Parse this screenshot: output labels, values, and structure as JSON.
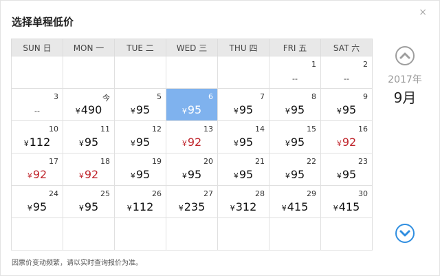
{
  "title": "选择单程低价",
  "close_symbol": "×",
  "weekdays": [
    "SUN 日",
    "MON 一",
    "TUE 二",
    "WED 三",
    "THU 四",
    "FRI 五",
    "SAT 六"
  ],
  "currency": "¥",
  "weeks": [
    [
      {
        "day": "",
        "price": ""
      },
      {
        "day": "",
        "price": ""
      },
      {
        "day": "",
        "price": ""
      },
      {
        "day": "",
        "price": ""
      },
      {
        "day": "",
        "price": ""
      },
      {
        "day": "1",
        "price": "--"
      },
      {
        "day": "2",
        "price": "--"
      }
    ],
    [
      {
        "day": "3",
        "price": "--"
      },
      {
        "day": "今",
        "price": "490"
      },
      {
        "day": "5",
        "price": "95"
      },
      {
        "day": "6",
        "price": "95",
        "selected": true
      },
      {
        "day": "7",
        "price": "95"
      },
      {
        "day": "8",
        "price": "95"
      },
      {
        "day": "9",
        "price": "95"
      }
    ],
    [
      {
        "day": "10",
        "price": "112"
      },
      {
        "day": "11",
        "price": "95"
      },
      {
        "day": "12",
        "price": "95"
      },
      {
        "day": "13",
        "price": "92",
        "low": true
      },
      {
        "day": "14",
        "price": "95"
      },
      {
        "day": "15",
        "price": "95"
      },
      {
        "day": "16",
        "price": "92",
        "low": true
      }
    ],
    [
      {
        "day": "17",
        "price": "92",
        "low": true
      },
      {
        "day": "18",
        "price": "92",
        "low": true
      },
      {
        "day": "19",
        "price": "95"
      },
      {
        "day": "20",
        "price": "95"
      },
      {
        "day": "21",
        "price": "95"
      },
      {
        "day": "22",
        "price": "95"
      },
      {
        "day": "23",
        "price": "95"
      }
    ],
    [
      {
        "day": "24",
        "price": "95"
      },
      {
        "day": "25",
        "price": "95"
      },
      {
        "day": "26",
        "price": "112"
      },
      {
        "day": "27",
        "price": "235"
      },
      {
        "day": "28",
        "price": "312"
      },
      {
        "day": "29",
        "price": "415"
      },
      {
        "day": "30",
        "price": "415"
      }
    ],
    [
      {
        "day": "",
        "price": ""
      },
      {
        "day": "",
        "price": ""
      },
      {
        "day": "",
        "price": ""
      },
      {
        "day": "",
        "price": ""
      },
      {
        "day": "",
        "price": ""
      },
      {
        "day": "",
        "price": ""
      },
      {
        "day": "",
        "price": ""
      }
    ]
  ],
  "side": {
    "year": "2017年",
    "month": "9月"
  },
  "note": "因票价变动频繁，请以实时查询报价为准。",
  "colors": {
    "selected_bg": "#7fb2ee",
    "low_price": "#c0262d",
    "nav_active": "#2f8ee0",
    "nav_inactive": "#9e9e9e"
  }
}
